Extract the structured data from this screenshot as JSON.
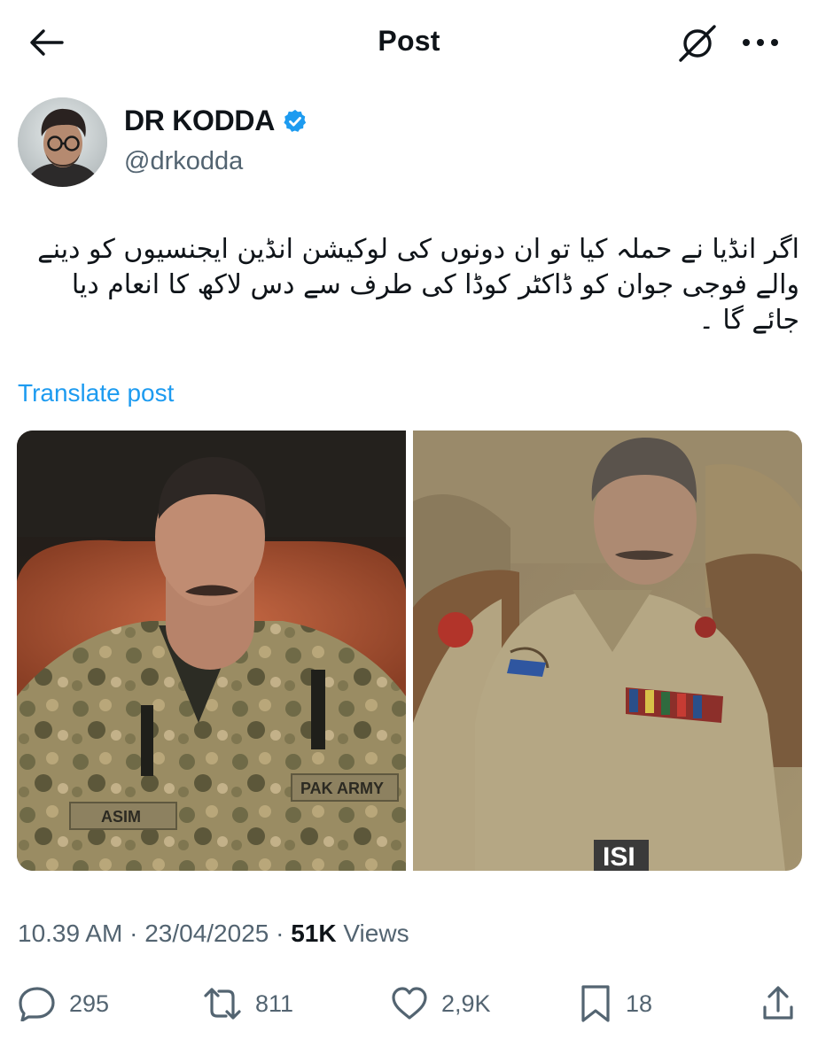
{
  "header": {
    "title": "Post",
    "back_icon": "arrow-left-icon",
    "grok_icon": "grok-slash-icon",
    "more_icon": "more-horizontal-icon"
  },
  "author": {
    "display_name": "DR KODDA",
    "handle": "@drkodda",
    "verified": true,
    "verified_color": "#1d9bf0"
  },
  "post": {
    "text": "اگر انڈیا نے حملہ کیا تو ان دونوں کی لوکیشن انڈین ایجنسیوں کو دینے والے فوجی جوان کو ڈاکٹر کوڈا کی طرف سے دس لاکھ کا انعام دیا جائے گا ۔",
    "translate_label": "Translate post",
    "link_color": "#1d9bf0",
    "media": [
      {
        "icon": "photo-left",
        "overlay_text": ""
      },
      {
        "icon": "photo-right",
        "overlay_text": "ISI"
      }
    ]
  },
  "meta": {
    "time": "10.39 AM",
    "date": "23/04/2025",
    "views_count": "51K",
    "views_label": "Views",
    "separator": "·"
  },
  "actions": {
    "replies": "295",
    "reposts": "811",
    "likes": "2,9K",
    "bookmarks": "18"
  }
}
